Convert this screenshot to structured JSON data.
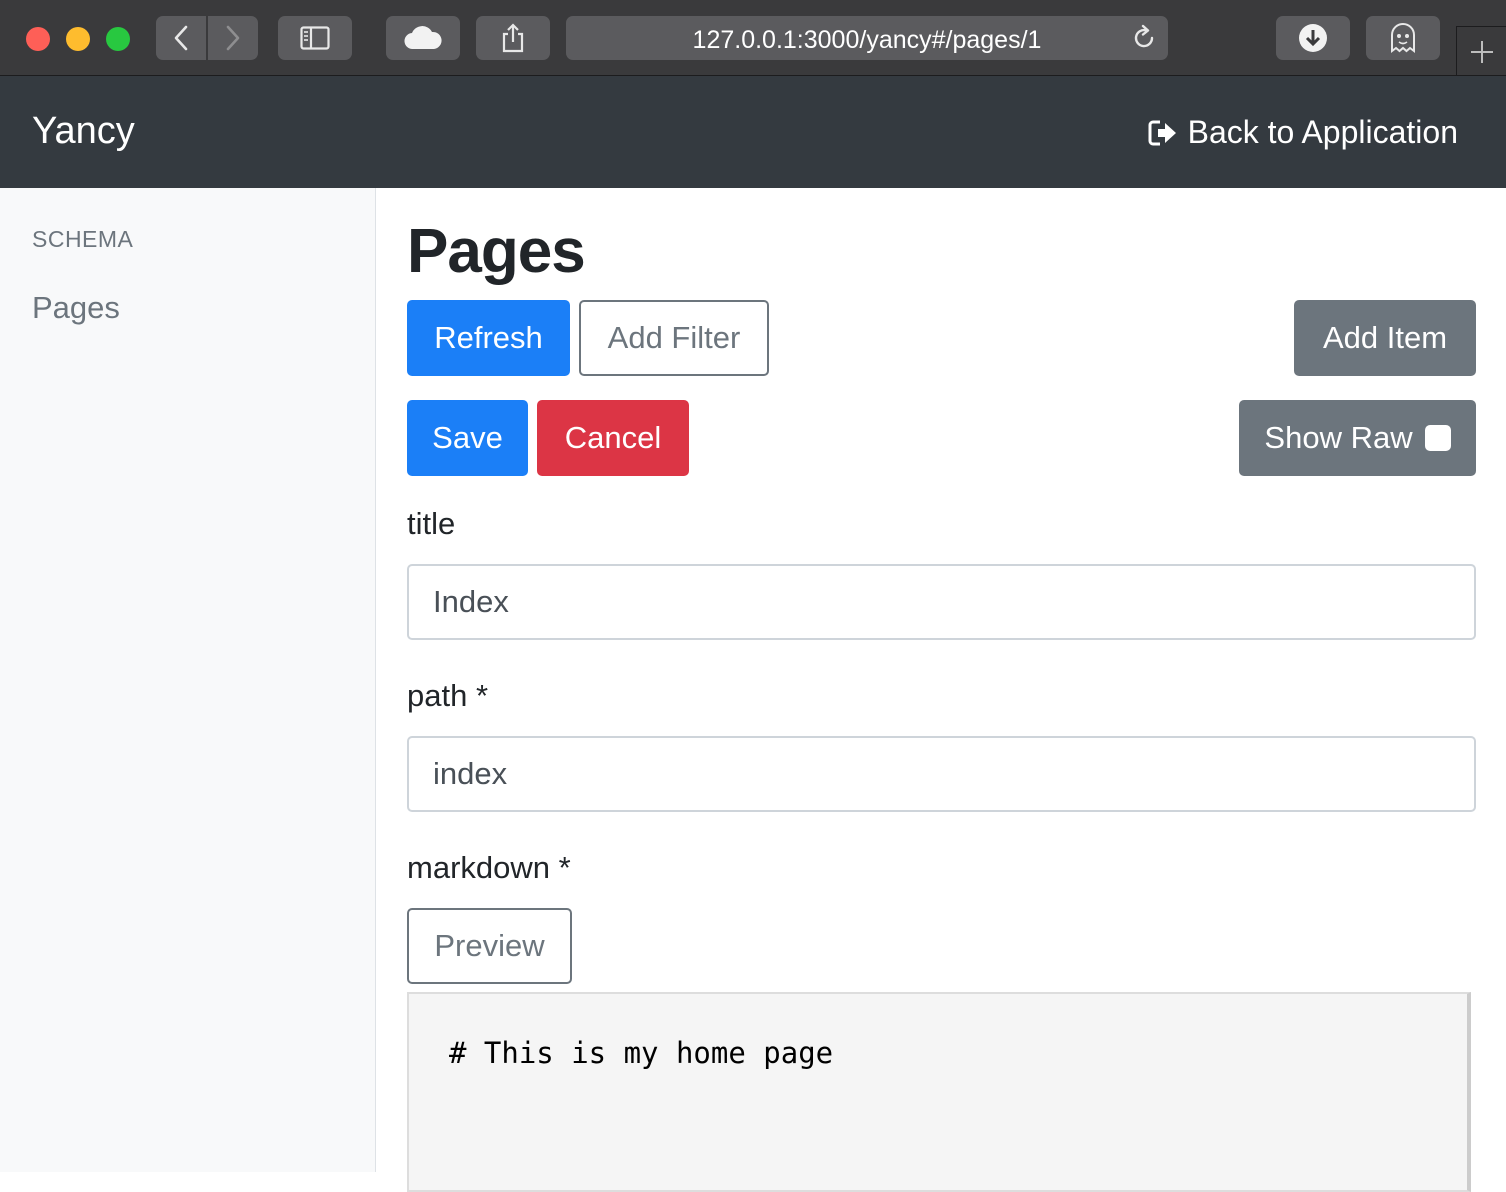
{
  "browser": {
    "url": "127.0.0.1:3000/yancy#/pages/1"
  },
  "navbar": {
    "brand": "Yancy",
    "back_link": "Back to Application"
  },
  "sidebar": {
    "heading": "SCHEMA",
    "items": [
      {
        "label": "Pages"
      }
    ]
  },
  "main": {
    "title": "Pages",
    "toolbar": {
      "refresh_label": "Refresh",
      "add_filter_label": "Add Filter",
      "add_item_label": "Add Item"
    },
    "editor": {
      "save_label": "Save",
      "cancel_label": "Cancel",
      "show_raw_label": "Show Raw",
      "show_raw_checked": false
    },
    "fields": {
      "title": {
        "label": "title",
        "value": "Index"
      },
      "path": {
        "label": "path *",
        "value": "index"
      },
      "markdown": {
        "label": "markdown *",
        "preview_label": "Preview",
        "content": "# This is my home page"
      }
    }
  },
  "colors": {
    "navbar": "#343a40",
    "primary": "#1b7ff7",
    "danger": "#dc3545",
    "secondary": "#6c757d",
    "sidebar_bg": "#f8f9fa"
  }
}
